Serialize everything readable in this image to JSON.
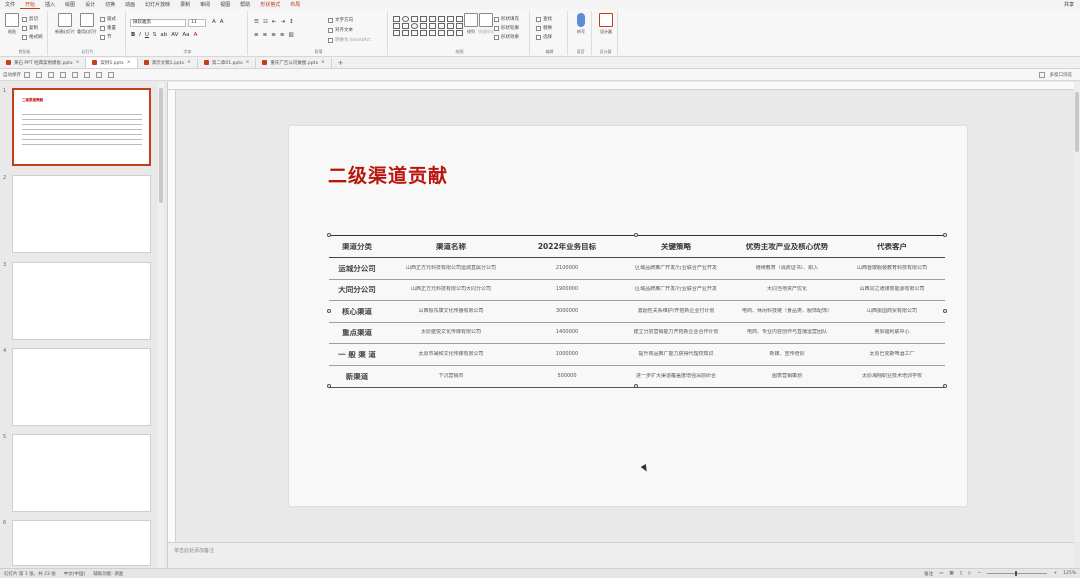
{
  "menu": {
    "items": [
      "文件",
      "开始",
      "插入",
      "绘图",
      "设计",
      "切换",
      "动画",
      "幻灯片放映",
      "录制",
      "审阅",
      "视图",
      "帮助",
      "形状格式",
      "布局"
    ],
    "active_index": 1,
    "contextual_indices": [
      12,
      13
    ],
    "share_label": "共享"
  },
  "ribbon": {
    "paste_label": "粘贴",
    "cut_label": "剪切",
    "copy_label": "复制",
    "format_painter_label": "格式刷",
    "clipboard_group": "剪贴板",
    "new_slide_label": "新建幻灯片",
    "reuse_slides_label": "重用幻灯片",
    "layout_label": "版式",
    "reset_label": "重置",
    "section_label": "节",
    "slides_group": "幻灯片",
    "font_name": "微软雅黑",
    "font_size": "11",
    "font_group": "字体",
    "paragraph_group": "段落",
    "text_direction_label": "文字方向",
    "align_text_label": "对齐文本",
    "smartart_label": "转换为 SmartArt",
    "drawing_group": "绘图",
    "arrange_label": "排列",
    "quick_styles_label": "快速样式",
    "shape_fill_label": "形状填充",
    "shape_outline_label": "形状轮廓",
    "shape_effects_label": "形状效果",
    "find_label": "查找",
    "replace_label": "替换",
    "select_label": "选择",
    "editing_group": "编辑",
    "dictate_label": "听写",
    "voice_group": "语音",
    "designer_label": "设计器",
    "designer_group": "设计器"
  },
  "doc_tabs": [
    {
      "label": "黄石 PPT 经典案例模板.pptx",
      "active": false
    },
    {
      "label": "案例5.pptx",
      "active": true
    },
    {
      "label": "演示文稿1.pptx",
      "active": false
    },
    {
      "label": "第二章01.pptx",
      "active": false
    },
    {
      "label": "重庆广告公司做图.pptx",
      "active": false
    }
  ],
  "quick_toolbar": {
    "label": "自动保存",
    "right_label": "多窗口浏览"
  },
  "thumbnails": {
    "numbers": [
      "1",
      "2",
      "3",
      "4",
      "5",
      "6"
    ],
    "selected_index": 0
  },
  "slide": {
    "title": "二级渠道贡献",
    "table": {
      "headers": [
        "渠道分类",
        "渠道名称",
        "2022年业务目标",
        "关键策略",
        "优势主攻产业及核心优势",
        "代表客户"
      ],
      "rows": [
        [
          "运城分公司",
          "山西正方元科技有限公司运城直属分公司",
          "2100000",
          "区域品牌推广开发/行业联合产业开发",
          "继续教育（消费证书）、职入",
          "山西晋嫂服装教育科技有限公司"
        ],
        [
          "大同分公司",
          "山西正方元科技有限公司大同分公司",
          "1900000",
          "区域品牌推广开发/行业联合产业开发",
          "大同当地资产优化",
          "山西同之通煤炭能源有限公司"
        ],
        [
          "核心渠道",
          "山西振东康文化传播有限公司",
          "3000000",
          "激励性关系维护/开拓新企业付计划",
          "电商、休闲科技链（食品类、服饰配饰）",
          "山西振国商贸有限公司"
        ],
        [
          "重点渠道",
          "太原盛悦文化传媒有限公司",
          "1400000",
          "建立分层营销能力开拓新企业合作计划",
          "电商、专业内容创作与直播运营团队",
          "英辰福利联中心"
        ],
        [
          "一 般 渠 道",
          "太原市晟和文化传媒有限公司",
          "1000000",
          "提升商品推广能力获得代理权知识",
          "新媒、宣传培训",
          "太原巴克斯啤酒工厂"
        ],
        [
          "新渠道",
          "下沉营销市",
          "500000",
          "进一步扩大渠道覆盖度增强深层研合",
          "图表营销策划",
          "太原海翔职业技术培训学校"
        ]
      ]
    }
  },
  "notes_placeholder": "单击此处添加备注",
  "status": {
    "slide_info": "幻灯片 第 1 张，共 23 张",
    "language": "中文(中国)",
    "accessibility": "辅助功能: 调查",
    "notes_label": "备注",
    "zoom": "125%"
  },
  "colors": {
    "accent": "#c43e1c",
    "title": "#b7170d"
  }
}
